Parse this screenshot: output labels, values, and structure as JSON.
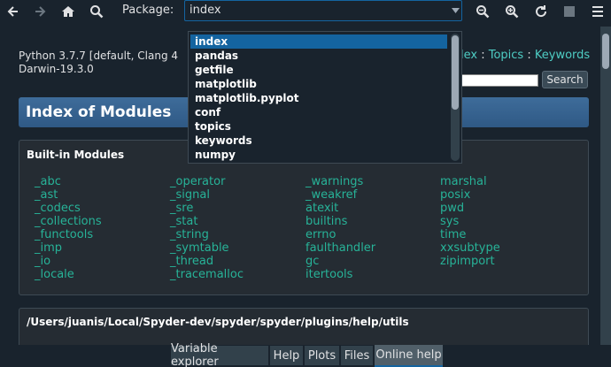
{
  "toolbar": {
    "icons": [
      "arrow-left-icon",
      "arrow-right-icon",
      "home-icon",
      "search-icon"
    ],
    "package_label": "Package:",
    "package_value": "index",
    "right_icons": [
      "zoom-out-icon",
      "zoom-in-icon",
      "refresh-icon",
      "stop-icon",
      "menu-icon"
    ]
  },
  "dropdown": {
    "items": [
      "index",
      "pandas",
      "getfile",
      "matplotlib",
      "matplotlib.pyplot",
      "conf",
      "topics",
      "keywords",
      "numpy"
    ],
    "selected": "index"
  },
  "page": {
    "python_info_line1": "Python 3.7.7 [default, Clang 4",
    "python_info_line2": "Darwin-19.3.0",
    "nav": {
      "link_index": "lex",
      "sep": " : ",
      "link_topics": "Topics",
      "link_keywords": "Keywords"
    },
    "search_button": "Search",
    "banner_title": "Index of Modules",
    "builtin_heading": "Built-in Modules",
    "modules": {
      "col1": [
        "_abc",
        "_ast",
        "_codecs",
        "_collections",
        "_functools",
        "_imp",
        "_io",
        "_locale"
      ],
      "col2": [
        "_operator",
        "_signal",
        "_sre",
        "_stat",
        "_string",
        "_symtable",
        "_thread",
        "_tracemalloc"
      ],
      "col3": [
        "_warnings",
        "_weakref",
        "atexit",
        "builtins",
        "errno",
        "faulthandler",
        "gc",
        "itertools"
      ],
      "col4": [
        "marshal",
        "posix",
        "pwd",
        "sys",
        "time",
        "xxsubtype",
        "zipimport"
      ]
    },
    "path_heading": "/Users/juanis/Local/Spyder-dev/spyder/spyder/plugins/help/utils"
  },
  "tabs": {
    "items": [
      "Variable explorer",
      "Help",
      "Plots",
      "Files",
      "Online help"
    ],
    "active": "Online help"
  },
  "colors": {
    "background": "#19232d",
    "accent": "#1464a0",
    "link": "#27b398",
    "banner": "#3e6c9a"
  }
}
